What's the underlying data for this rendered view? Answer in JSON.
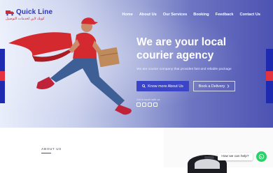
{
  "colors": {
    "brand_blue": "#2a36c2",
    "brand_red": "#c5303b",
    "button_blue": "#3a45c8",
    "whatsapp_green": "#25d366"
  },
  "logo": {
    "name": "Quick Line",
    "arabic": "كويك لاين لخدمات التوصيل",
    "icon": "truck-icon"
  },
  "nav": {
    "items": [
      "Home",
      "About Us",
      "Our Services",
      "Booking",
      "Feedback",
      "Contact Us"
    ]
  },
  "hero": {
    "title": "We are your local courier agency",
    "subtitle": "We are courier company that provides fast and reliable package",
    "primary_button": {
      "label": "Know more About Us",
      "icon": "search-icon"
    },
    "secondary_button": {
      "label": "Book a Delivery",
      "icon": "chevron-right-icon"
    },
    "touch_label": "Get in touch with us",
    "socials": [
      "instagram-icon",
      "facebook-icon",
      "email-icon",
      "twitter-icon"
    ]
  },
  "about": {
    "label": "ABOUT US"
  },
  "help": {
    "label": "How we can help?",
    "icon": "whatsapp-icon"
  }
}
